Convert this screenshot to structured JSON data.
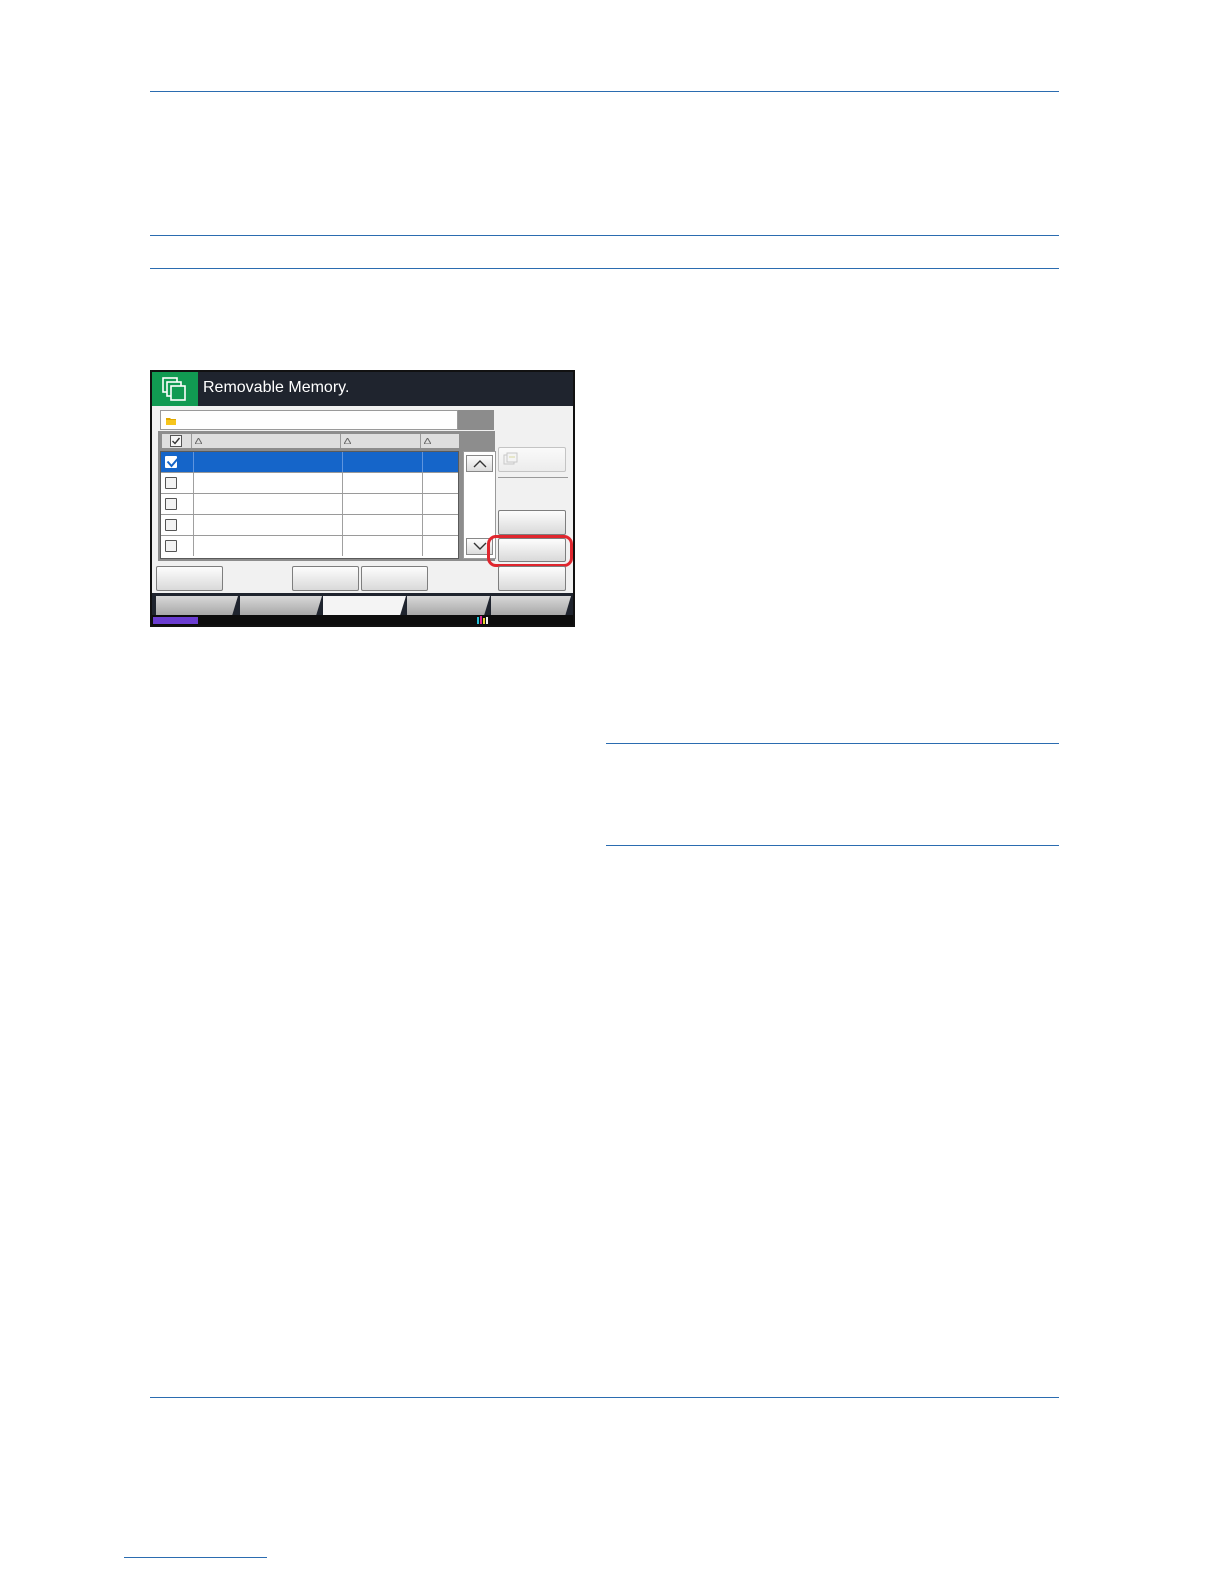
{
  "screen": {
    "title": "Removable Memory.",
    "title_icon": "removable-memory-icon",
    "path_icon": "folder-icon",
    "rows": [
      {
        "checked": true,
        "selected": true
      },
      {
        "checked": false,
        "selected": false
      },
      {
        "checked": false,
        "selected": false
      },
      {
        "checked": false,
        "selected": false
      },
      {
        "checked": false,
        "selected": false
      }
    ]
  },
  "colors": {
    "rule": "#2b6cb0",
    "title_icon_bg": "#119a52",
    "selection": "#1565c9",
    "highlight": "#e0262e",
    "status_indicator": "#6b3dd1"
  }
}
